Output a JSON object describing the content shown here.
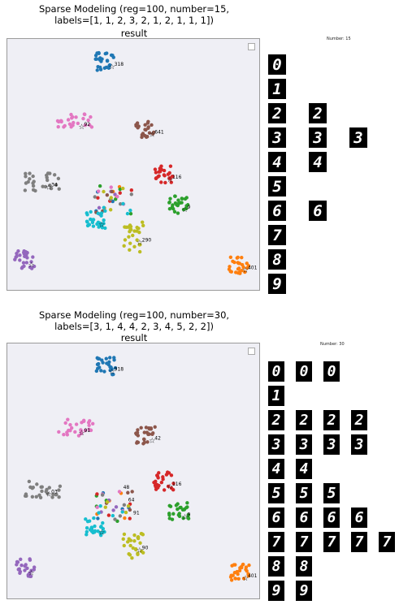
{
  "figures": [
    {
      "title": "Sparse Modeling (reg=100, number=15,\nlabels=[1, 1, 2, 3, 2, 1, 2, 1, 1, 1])",
      "subtitle": "result",
      "side_label": "Number: 15",
      "digit_columns": [
        [
          "0",
          "1",
          "2",
          "3",
          "4",
          "5",
          "6",
          "7",
          "8",
          "9"
        ],
        [
          "",
          "",
          "2",
          "3",
          "4",
          "",
          "6",
          "",
          "",
          ""
        ],
        [
          "",
          "",
          "",
          "3",
          "",
          "",
          "",
          "",
          "",
          ""
        ]
      ]
    },
    {
      "title": "Sparse Modeling (reg=100, number=30,\nlabels=[3, 1, 4, 4, 2, 3, 4, 5, 2, 2])",
      "subtitle": "result",
      "side_label": "Number: 30",
      "digit_columns": [
        [
          "0",
          "1",
          "2",
          "3",
          "4",
          "5",
          "6",
          "7",
          "8",
          "9"
        ],
        [
          "0",
          "",
          "2",
          "3",
          "4",
          "5",
          "6",
          "7",
          "8",
          "9"
        ],
        [
          "0",
          "",
          "2",
          "3",
          "",
          "5",
          "6",
          "7",
          "",
          ""
        ],
        [
          "",
          "",
          "2",
          "3",
          "",
          "",
          "6",
          "7",
          "",
          ""
        ],
        [
          "",
          "",
          "",
          "",
          "",
          "",
          "",
          "7",
          "",
          ""
        ]
      ]
    }
  ],
  "chart_data": [
    {
      "type": "scatter",
      "title": "result",
      "grid": false,
      "legend": "top-right (empty box)",
      "clusters": [
        {
          "color": "#1f77b4",
          "center": [
            0.39,
            0.09
          ],
          "label": "318"
        },
        {
          "color": "#ff7f0e",
          "center": [
            0.92,
            0.9
          ],
          "label": "401"
        },
        {
          "color": "#2ca02c",
          "center": [
            0.68,
            0.66
          ],
          "label": "9"
        },
        {
          "color": "#d62728",
          "center": [
            0.62,
            0.54
          ],
          "label": "116"
        },
        {
          "color": "#9467bd",
          "center": [
            0.07,
            0.88
          ],
          "label": ""
        },
        {
          "color": "#8c564b",
          "center": [
            0.55,
            0.36
          ],
          "label": "641"
        },
        {
          "color": "#e377c2",
          "center": [
            0.27,
            0.33
          ],
          "label": "92"
        },
        {
          "color": "#7f7f7f",
          "center": [
            0.14,
            0.57
          ],
          "label": "34"
        },
        {
          "color": "#bcbd22",
          "center": [
            0.5,
            0.79
          ],
          "label": "290"
        },
        {
          "color": "#17becf",
          "center": [
            0.35,
            0.72
          ],
          "label": ""
        }
      ]
    },
    {
      "type": "scatter",
      "title": "result",
      "grid": false,
      "legend": "top-right (empty box)",
      "clusters": [
        {
          "color": "#1f77b4",
          "center": [
            0.39,
            0.09
          ],
          "label": "918"
        },
        {
          "color": "#ff7f0e",
          "center": [
            0.92,
            0.9
          ],
          "label": "401"
        },
        {
          "color": "#2ca02c",
          "center": [
            0.68,
            0.66
          ],
          "label": "9"
        },
        {
          "color": "#d62728",
          "center": [
            0.62,
            0.54
          ],
          "label": "116"
        },
        {
          "color": "#9467bd",
          "center": [
            0.07,
            0.88
          ],
          "label": ""
        },
        {
          "color": "#8c564b",
          "center": [
            0.55,
            0.36
          ],
          "label": "42"
        },
        {
          "color": "#e377c2",
          "center": [
            0.27,
            0.33
          ],
          "label": "91"
        },
        {
          "color": "#7f7f7f",
          "center": [
            0.14,
            0.57
          ],
          "label": "03"
        },
        {
          "color": "#bcbd22",
          "center": [
            0.5,
            0.79
          ],
          "label": "90"
        },
        {
          "color": "#17becf",
          "center": [
            0.35,
            0.72
          ],
          "label": ""
        }
      ],
      "extra_labels": [
        "48",
        "64",
        "91"
      ]
    }
  ]
}
